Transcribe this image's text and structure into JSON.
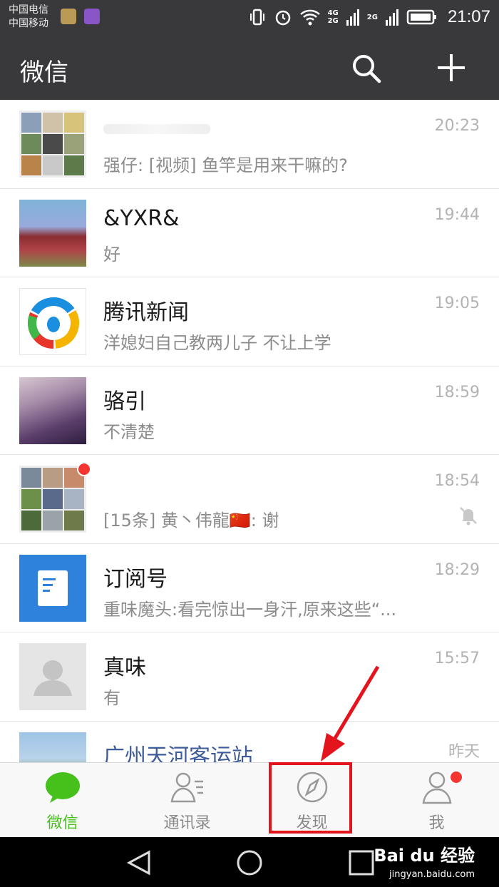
{
  "status_bar": {
    "carrier_1": "中国电信",
    "carrier_2": "中国移动",
    "network_1": "4G",
    "network_1b": "2G",
    "network_2": "2G",
    "time": "21:07"
  },
  "header": {
    "title": "微信"
  },
  "colors": {
    "header_bg": "#39393c",
    "accent_green": "#46c11b",
    "badge_red": "#f43531",
    "highlight_red": "#e4141c"
  },
  "chats": [
    {
      "name": "",
      "message": "强仔: [视频] 鱼竿是用来干嘛的?",
      "time": "20:23"
    },
    {
      "name": "&YXR&",
      "message": "好",
      "time": "19:44"
    },
    {
      "name": "腾讯新闻",
      "message": "洋媳妇自己教两儿子 不让上学",
      "time": "19:05"
    },
    {
      "name": "骆引",
      "message": "不清楚",
      "time": "18:59"
    },
    {
      "name": "",
      "message": "[15条] 黄丶伟龍🇨🇳: 谢",
      "time": "18:54"
    },
    {
      "name": "订阅号",
      "message": "重味魔头:看完惊出一身汗,原来这些“...",
      "time": "18:29"
    },
    {
      "name": "真味",
      "message": "有",
      "time": "15:57"
    },
    {
      "name": "广州天河客运站",
      "message": "",
      "time": "昨天"
    }
  ],
  "tabs": [
    {
      "label": "微信",
      "icon": "chat-bubble-icon"
    },
    {
      "label": "通讯录",
      "icon": "contacts-icon"
    },
    {
      "label": "发现",
      "icon": "compass-icon"
    },
    {
      "label": "我",
      "icon": "person-icon"
    }
  ],
  "watermark": {
    "text": "Bai du 经验",
    "url": "jingyan.baidu.com"
  }
}
